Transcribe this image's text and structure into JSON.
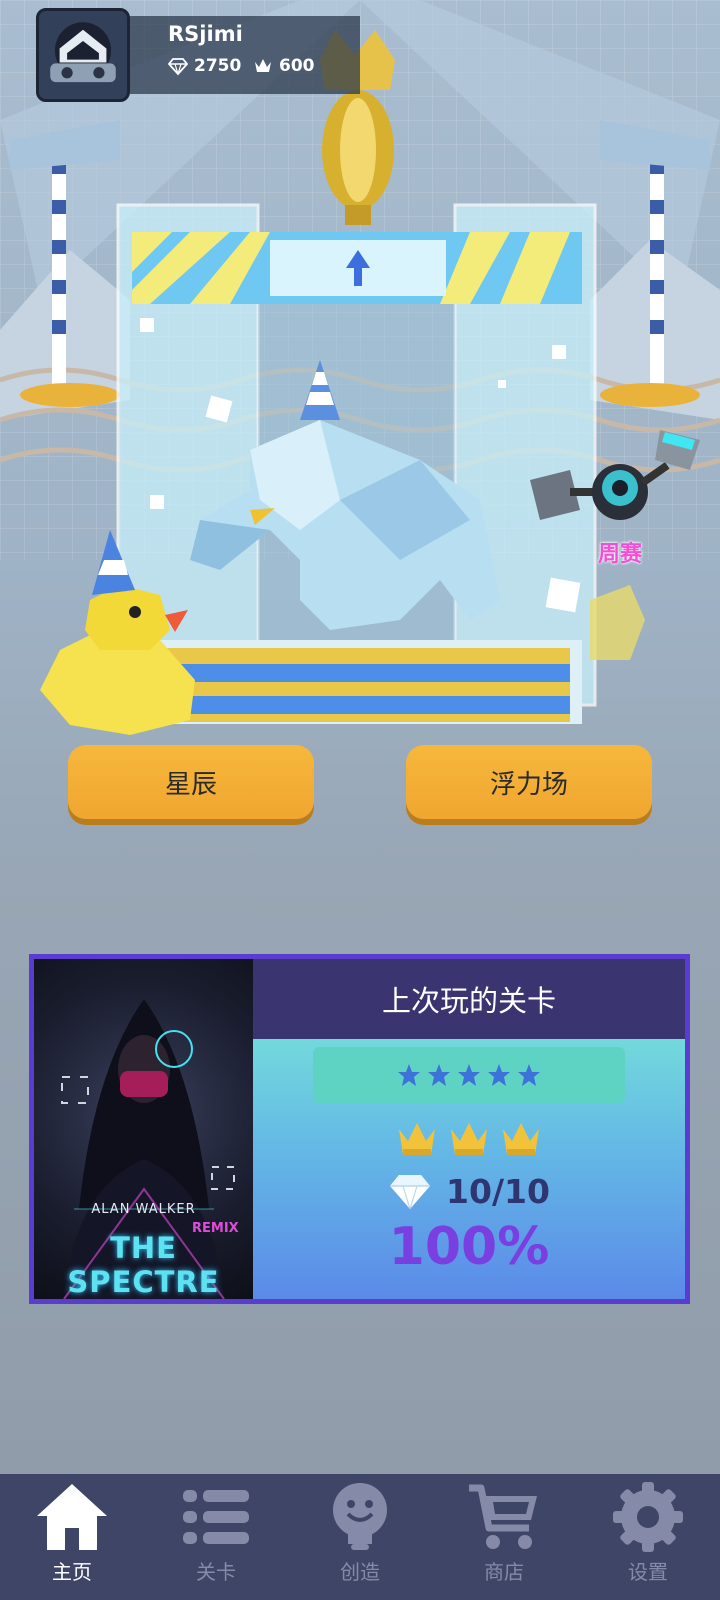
{
  "profile": {
    "username": "RSjimi",
    "gems": "2750",
    "crowns": "600"
  },
  "modes": {
    "left_label": "星辰",
    "right_label": "浮力场",
    "weekly_label": "周赛"
  },
  "last_played": {
    "header": "上次玩的关卡",
    "difficulty_stars": 5,
    "crowns_earned": 3,
    "gems": "10/10",
    "percent": "100%",
    "cover": {
      "artist": "ALAN WALKER",
      "remix": "REMIX",
      "title": "THE SPECTRE"
    }
  },
  "nav": {
    "items": [
      {
        "label": "主页",
        "icon": "home-icon",
        "active": true
      },
      {
        "label": "关卡",
        "icon": "list-icon",
        "active": false
      },
      {
        "label": "创造",
        "icon": "lightbulb-icon",
        "active": false
      },
      {
        "label": "商店",
        "icon": "cart-icon",
        "active": false
      },
      {
        "label": "设置",
        "icon": "gear-icon",
        "active": false
      }
    ]
  },
  "colors": {
    "button": "#f3ae36",
    "card_border": "#5b3cd0",
    "nav_bg": "#3f4566",
    "percent": "#7a3fe0",
    "weekly": "#f24fd6"
  }
}
